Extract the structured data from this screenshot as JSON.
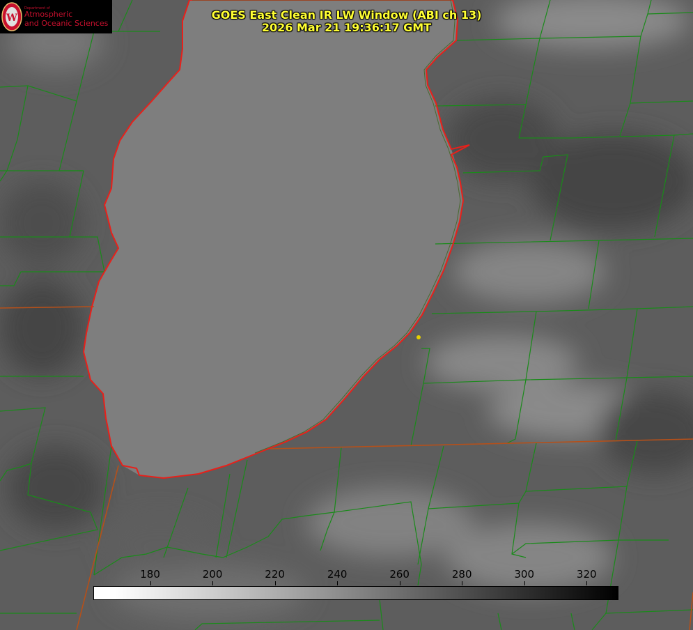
{
  "logo": {
    "department": "Department of",
    "line1": "Atmospheric",
    "line2": "and Oceanic Sciences",
    "seal_text": "W"
  },
  "header": {
    "title_line1": "GOES East Clean IR LW Window (ABI ch 13)",
    "title_line2": "2026 Mar 21 19:36:17 GMT"
  },
  "colorbar": {
    "ticks": [
      "180",
      "200",
      "220",
      "240",
      "260",
      "280",
      "300",
      "320"
    ],
    "range": [
      162,
      330
    ],
    "colormap": "white (cold) to black (warm)"
  },
  "colors": {
    "county_lines": "#1a8a1a",
    "state_lines": "#b5501a",
    "lake_outline": "#e8201a",
    "title_text": "#ffff33",
    "marker": "#e6d000"
  }
}
